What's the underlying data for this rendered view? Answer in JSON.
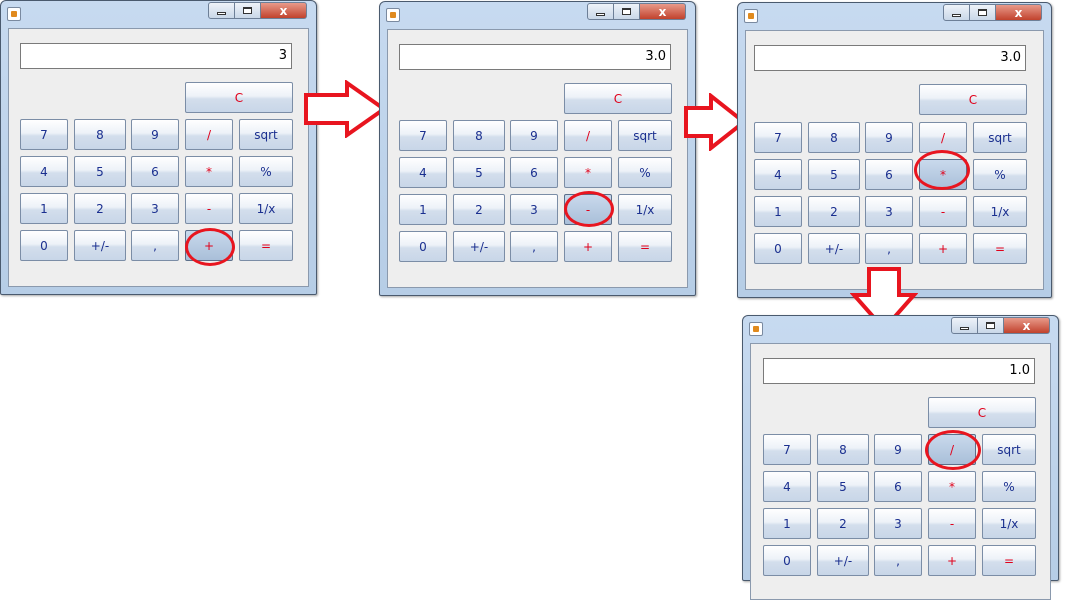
{
  "calculators": [
    {
      "display": "3",
      "highlighted": "+"
    },
    {
      "display": "3.0",
      "highlighted": "-"
    },
    {
      "display": "3.0",
      "highlighted": "*"
    },
    {
      "display": "1.0",
      "highlighted": "/"
    }
  ],
  "keys": {
    "clear": "C",
    "row1": [
      "7",
      "8",
      "9",
      "/",
      "sqrt"
    ],
    "row2": [
      "4",
      "5",
      "6",
      "*",
      "%"
    ],
    "row3": [
      "1",
      "2",
      "3",
      "-",
      "1/x"
    ],
    "row4": [
      "0",
      "+/-",
      ",",
      "+",
      "="
    ]
  },
  "title_controls": {
    "close": "x"
  },
  "colors": {
    "digit_text": "#1a2f8f",
    "operator_text": "#e0001a",
    "annotation": "#e8151f"
  }
}
